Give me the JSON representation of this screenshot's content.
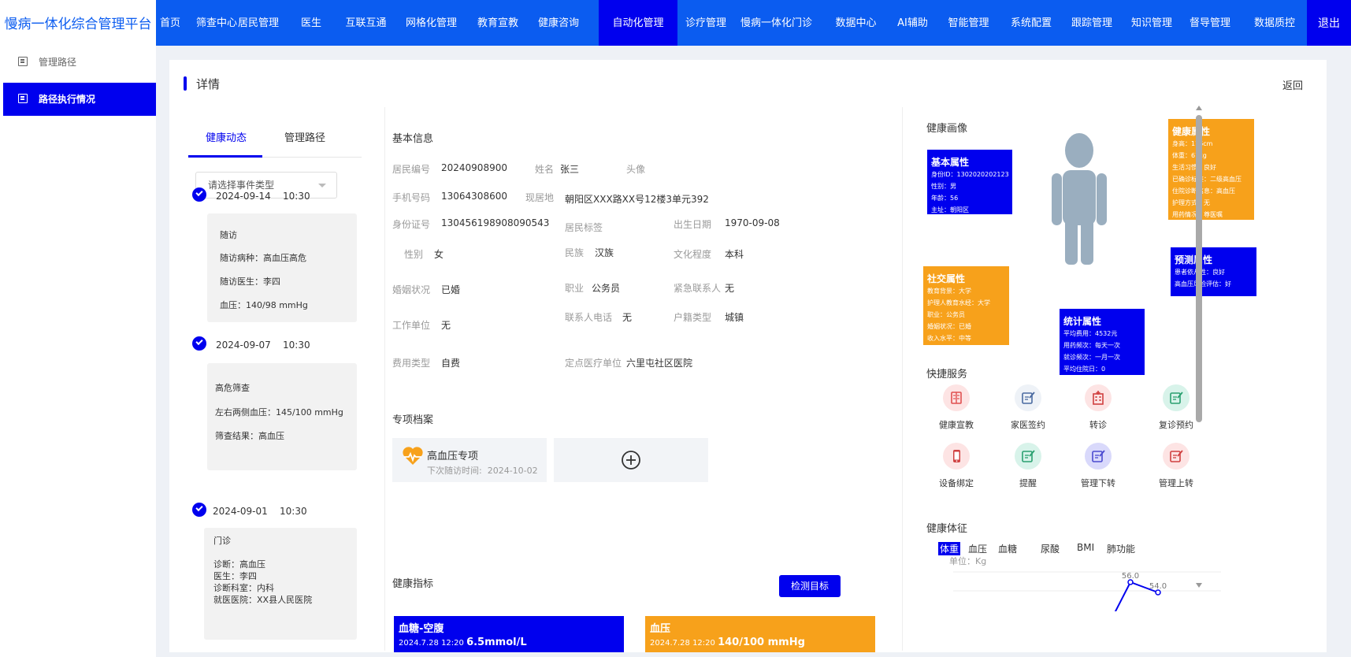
{
  "app": {
    "title": "慢病一体化综合管理平台",
    "logout": "退出"
  },
  "nav": [
    {
      "label": "首页",
      "active": false
    },
    {
      "label": "筛查中心",
      "active": false
    },
    {
      "label": "居民管理",
      "active": false
    },
    {
      "label": "医生",
      "active": false
    },
    {
      "label": "互联互通",
      "active": false
    },
    {
      "label": "网格化管理",
      "active": false
    },
    {
      "label": "教育宣教",
      "active": false
    },
    {
      "label": "健康咨询",
      "active": false
    },
    {
      "label": "自动化管理",
      "active": true
    },
    {
      "label": "诊疗管理",
      "active": false
    },
    {
      "label": "慢病一体化门诊",
      "active": false
    },
    {
      "label": "数据中心",
      "active": false
    },
    {
      "label": "AI辅助",
      "active": false
    },
    {
      "label": "智能管理",
      "active": false
    },
    {
      "label": "系统配置",
      "active": false
    },
    {
      "label": "跟踪管理",
      "active": false
    },
    {
      "label": "知识管理",
      "active": false
    },
    {
      "label": "督导管理",
      "active": false
    },
    {
      "label": "数据质控",
      "active": false
    }
  ],
  "sidebar": [
    {
      "label": "管理路径",
      "active": false
    },
    {
      "label": "路径执行情况",
      "active": true
    }
  ],
  "page": {
    "title": "详情",
    "back": "返回"
  },
  "left_tabs": [
    "健康动态",
    "管理路径"
  ],
  "event_select": {
    "placeholder": "请选择事件类型"
  },
  "timeline": [
    {
      "date": "2024-09-14",
      "time": "10:30",
      "lines": [
        "随访",
        "随访病种：高血压高危",
        "随访医生：李四",
        "血压：140/98 mmHg"
      ]
    },
    {
      "date": "2024-09-07",
      "time": "10:30",
      "lines": [
        "高危筛查",
        "左右两侧血压：145/100 mmHg",
        "筛查结果：高血压"
      ]
    },
    {
      "date": "2024-09-01",
      "time": "10:30",
      "lines": [
        "门诊",
        "诊断：高血压",
        "医生：李四",
        "诊断科室：内科",
        "就医医院：XX县人民医院"
      ]
    }
  ],
  "basic_info": {
    "title": "基本信息",
    "fields": [
      {
        "label": "居民编号",
        "value": "20240908900"
      },
      {
        "label": "姓名",
        "value": "张三"
      },
      {
        "label": "头像",
        "value": ""
      },
      {
        "label": "手机号码",
        "value": "13064308600"
      },
      {
        "label": "现居地",
        "value": "朝阳区XXX路XX号12楼3单元392"
      },
      {
        "label": "身份证号",
        "value": "130456198908090543"
      },
      {
        "label": "居民标签",
        "value": ""
      },
      {
        "label": "出生日期",
        "value": "1970-09-08"
      },
      {
        "label": "性别",
        "value": "女"
      },
      {
        "label": "民族",
        "value": "汉族"
      },
      {
        "label": "文化程度",
        "value": "本科"
      },
      {
        "label": "婚姻状况",
        "value": "已婚"
      },
      {
        "label": "职业",
        "value": "公务员"
      },
      {
        "label": "紧急联系人",
        "value": "无"
      },
      {
        "label": "工作单位",
        "value": "无"
      },
      {
        "label": "联系人电话",
        "value": "无"
      },
      {
        "label": "户籍类型",
        "value": "城镇"
      },
      {
        "label": "费用类型",
        "value": "自费"
      },
      {
        "label": "定点医疗单位",
        "value": "六里屯社区医院"
      }
    ]
  },
  "special_records": {
    "title": "专项档案",
    "items": [
      {
        "name": "高血压专项",
        "next_label": "下次随访时间:",
        "next_date": "2024-10-02"
      }
    ]
  },
  "health_indicators": {
    "title": "健康指标",
    "button": "检测目标",
    "cards": [
      {
        "name": "血糖-空腹",
        "time": "2024.7.28 12:20",
        "value": "6.5mmol/L",
        "color": "#0000ee"
      },
      {
        "name": "血压",
        "time": "2024.7.28 12:20",
        "value": "140/100 mmHg",
        "color": "#f7a11b"
      }
    ]
  },
  "portrait": {
    "title": "健康画像",
    "groups": [
      {
        "title": "基本属性",
        "lines": [
          "身份ID：1302020202123",
          "性别：男",
          "年龄：56",
          "主址：朝阳区"
        ],
        "color": "#0000ee"
      },
      {
        "title": "健康属性",
        "lines": [
          "身高：176cm",
          "体重：67kg",
          "生活习惯：良好",
          "已确诊标签：二级高血压",
          "住院诊断信息：高血压",
          "护理方式：无",
          "用药情况：尊医嘱"
        ],
        "color": "#f7a11b"
      },
      {
        "title": "预测属性",
        "lines": [
          "患者依从性：良好",
          "高血压风险评估：好"
        ],
        "color": "#0000ee"
      },
      {
        "title": "社交属性",
        "lines": [
          "教育背景：大学",
          "护理人教育水经：大学",
          "职业：公务员",
          "婚姻状况：已婚",
          "收入水平：中等"
        ],
        "color": "#f7a11b"
      },
      {
        "title": "统计属性",
        "lines": [
          "平均费用：4532元",
          "用药频次：每天一次",
          "就诊频次：一月一次",
          "平均住院日：0"
        ],
        "color": "#0000ee"
      }
    ]
  },
  "quick_services": {
    "title": "快捷服务",
    "items": [
      {
        "label": "健康宣教",
        "icon": "book-icon",
        "bg": "#fde4e4",
        "fg": "#e05050"
      },
      {
        "label": "家医签约",
        "icon": "edit-icon",
        "bg": "#eef2f7",
        "fg": "#4a6aa0"
      },
      {
        "label": "转诊",
        "icon": "hospital-icon",
        "bg": "#fde4e4",
        "fg": "#d04040"
      },
      {
        "label": "复诊预约",
        "icon": "edit-icon",
        "bg": "#d8f3ea",
        "fg": "#2aa070"
      },
      {
        "label": "设备绑定",
        "icon": "phone-icon",
        "bg": "#fde4e4",
        "fg": "#d04040"
      },
      {
        "label": "提醒",
        "icon": "edit-icon",
        "bg": "#d8f3ea",
        "fg": "#2aa070"
      },
      {
        "label": "管理下转",
        "icon": "edit-icon",
        "bg": "#d9d9fb",
        "fg": "#4a4ad0"
      },
      {
        "label": "管理上转",
        "icon": "edit-icon",
        "bg": "#fde4e4",
        "fg": "#d04040"
      }
    ]
  },
  "vital_signs": {
    "title": "健康体征",
    "tabs": [
      "体重",
      "血压",
      "血糖",
      "尿酸",
      "BMI",
      "肺功能"
    ],
    "active_tab": "体重",
    "unit": "单位：Kg"
  },
  "chart_data": {
    "type": "line",
    "title": "",
    "ylabel": "单位：Kg",
    "x": [
      "1",
      "2",
      "3"
    ],
    "values": [
      50.0,
      56.0,
      54.0
    ],
    "data_labels": [
      "",
      "56.0",
      "54.0"
    ],
    "ylim": [
      50,
      58
    ]
  }
}
